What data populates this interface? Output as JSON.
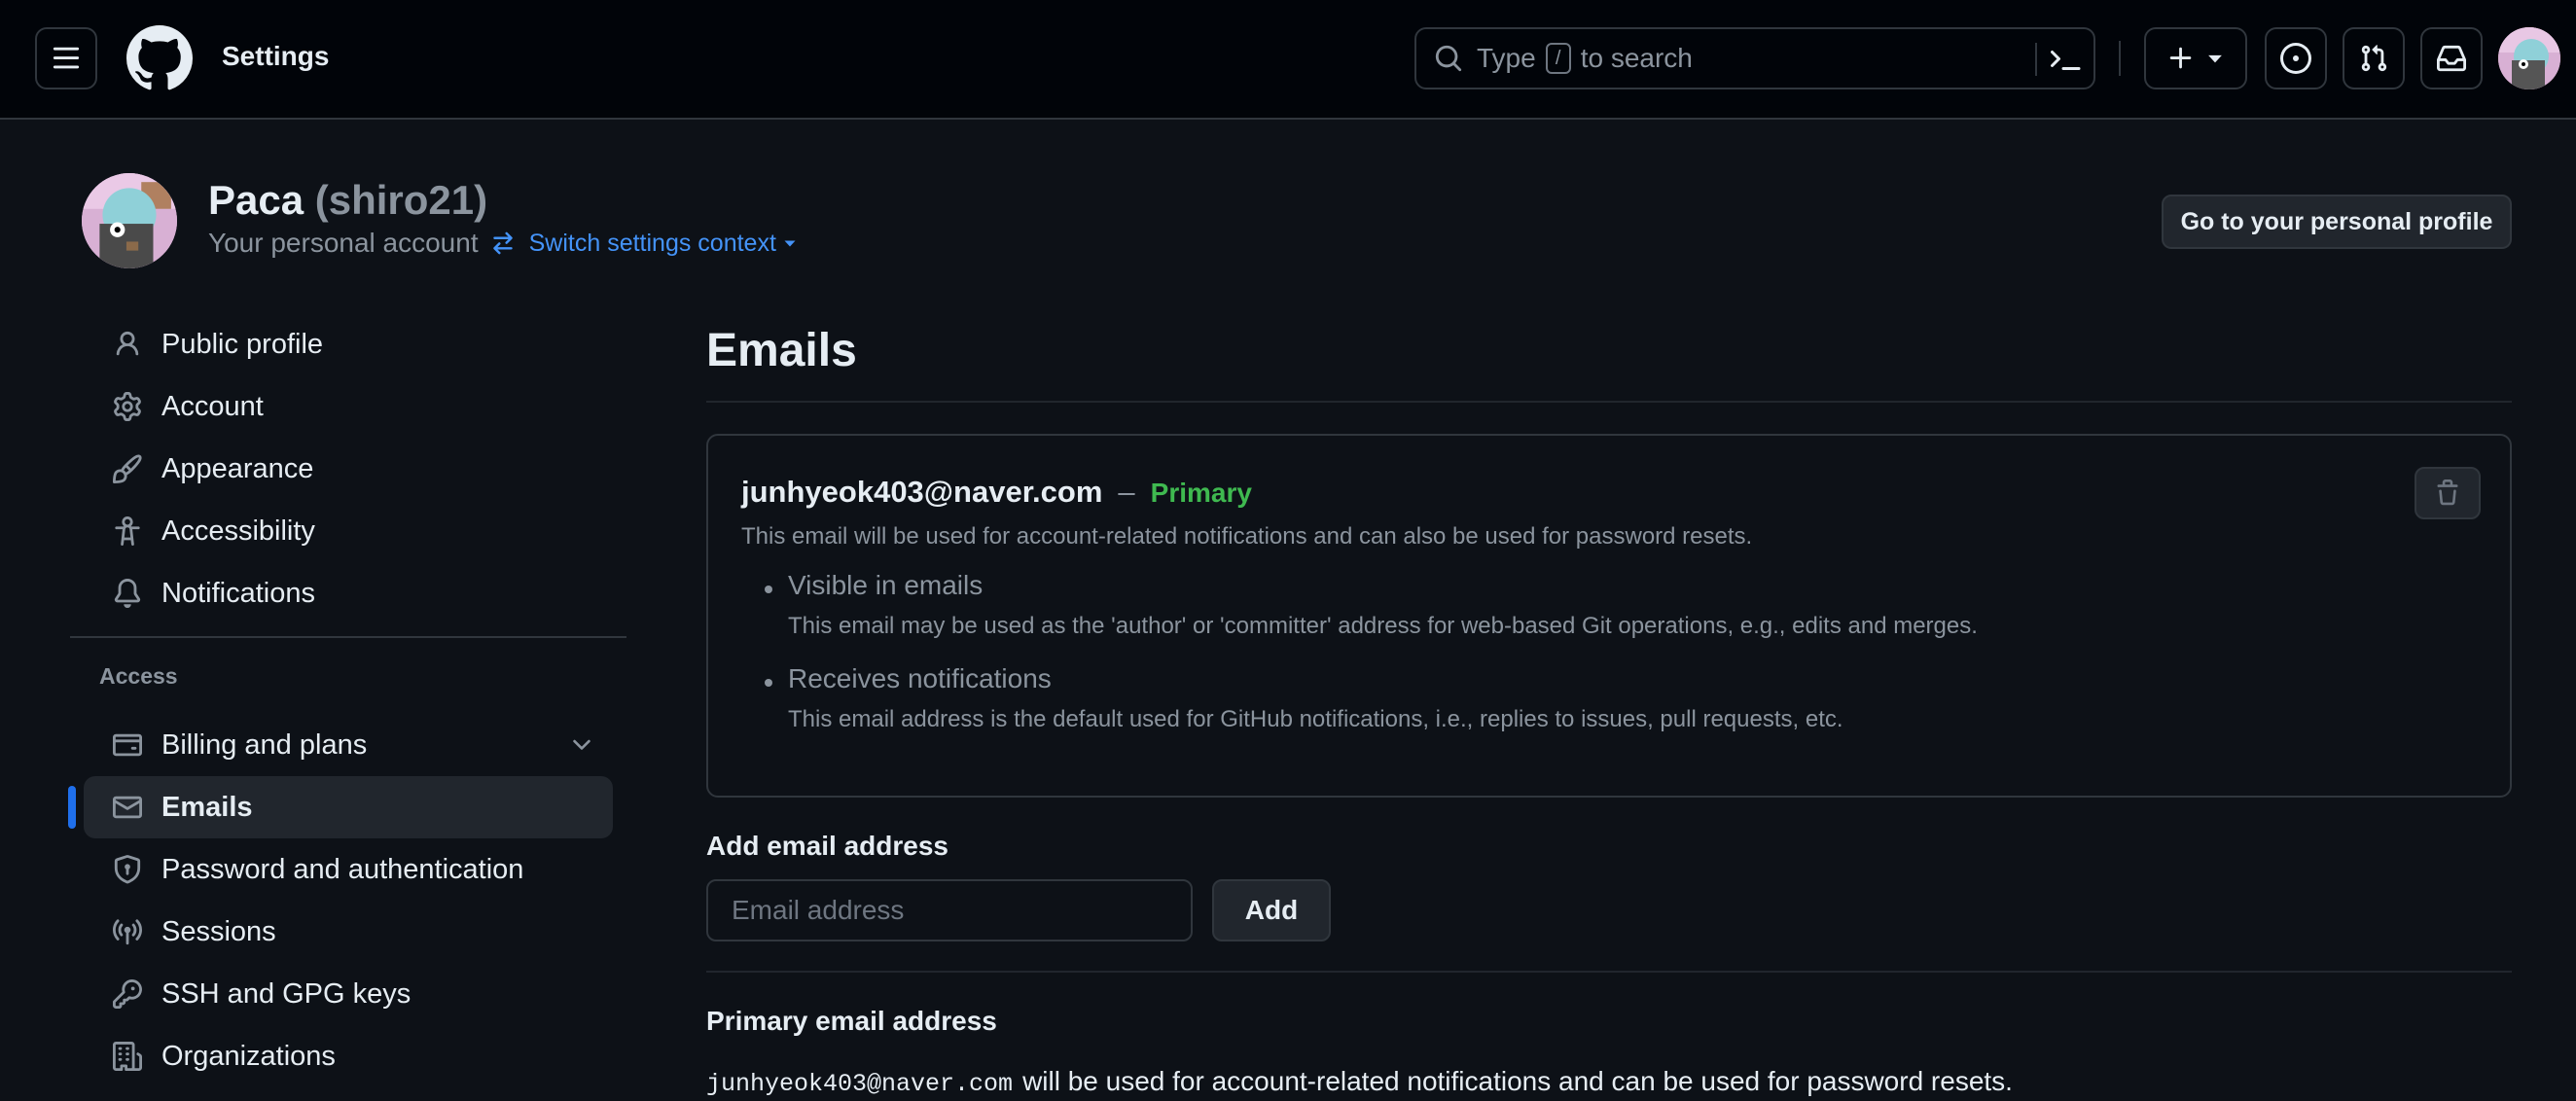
{
  "header": {
    "title": "Settings",
    "search_prefix": "Type",
    "search_key": "/",
    "search_suffix": "to search",
    "icons": [
      "hamburger-icon",
      "github-logo-icon",
      "search-icon",
      "terminal-icon",
      "plus-icon",
      "issues-icon",
      "pull-requests-icon",
      "inbox-icon"
    ]
  },
  "profile": {
    "name": "Paca",
    "handle": "(shiro21)",
    "account_type": "Your personal account",
    "switch_label": "Switch settings context",
    "go_profile_label": "Go to your personal profile"
  },
  "sidebar": {
    "items": [
      {
        "label": "Public profile",
        "icon": "person-icon"
      },
      {
        "label": "Account",
        "icon": "gear-icon"
      },
      {
        "label": "Appearance",
        "icon": "paintbrush-icon"
      },
      {
        "label": "Accessibility",
        "icon": "accessibility-icon"
      },
      {
        "label": "Notifications",
        "icon": "bell-icon"
      }
    ],
    "access_heading": "Access",
    "access_items": [
      {
        "label": "Billing and plans",
        "icon": "credit-card-icon"
      },
      {
        "label": "Emails",
        "icon": "mail-icon",
        "active": true
      },
      {
        "label": "Password and authentication",
        "icon": "shield-icon"
      },
      {
        "label": "Sessions",
        "icon": "broadcast-icon"
      },
      {
        "label": "SSH and GPG keys",
        "icon": "key-icon"
      },
      {
        "label": "Organizations",
        "icon": "organization-icon"
      }
    ]
  },
  "main": {
    "title": "Emails",
    "primary_email": {
      "address": "junhyeok403@naver.com",
      "dash": "–",
      "badge": "Primary",
      "description": "This email will be used for account-related notifications and can also be used for password resets.",
      "bullets": [
        {
          "title": "Visible in emails",
          "desc": "This email may be used as the 'author' or 'committer' address for web-based Git operations, e.g., edits and merges."
        },
        {
          "title": "Receives notifications",
          "desc": "This email address is the default used for GitHub notifications, i.e., replies to issues, pull requests, etc."
        }
      ]
    },
    "add_email": {
      "heading": "Add email address",
      "placeholder": "Email address",
      "button": "Add"
    },
    "primary_section": {
      "heading": "Primary email address",
      "email": "junhyeok403@naver.com",
      "text": "will be used for account-related notifications and can be used for password resets."
    }
  },
  "colors": {
    "bg": "#0d1117",
    "header_bg": "#010409",
    "border": "#30363d",
    "accent": "#1f6feb",
    "link": "#4493f8",
    "success": "#3fb950",
    "muted": "#8b949e"
  }
}
